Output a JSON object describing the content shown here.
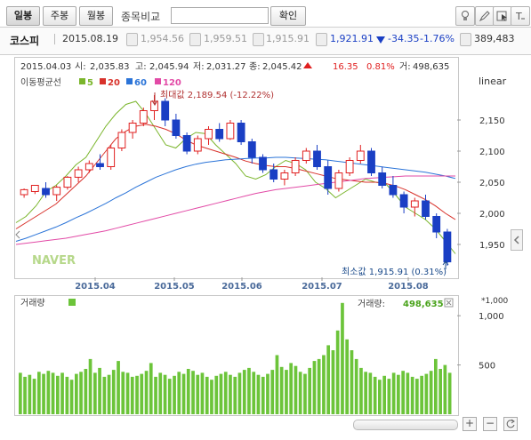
{
  "toolbar": {
    "daily_label": "일봉",
    "weekly_label": "주봉",
    "monthly_label": "월봉",
    "compare_label": "종목비교",
    "compare_input_value": "",
    "confirm_label": "확인"
  },
  "quote": {
    "name": "코스피",
    "date": "2015.08.19",
    "open": "1,954.56",
    "high": "1,959.51",
    "low": "1,915.91",
    "close": "1,921.91",
    "change": "-34.35",
    "change_rate": "-1.76%",
    "volume": "389,483"
  },
  "info_bar": {
    "date": "2015.04.03",
    "open_label": "시:",
    "open": "2,035.83",
    "high_label": "고:",
    "high": "2,045.94",
    "low_label": "저:",
    "low": "2,031.27",
    "close_label": "종:",
    "close": "2,045.42",
    "change": "16.35",
    "change_rate": "0.81%",
    "volume_label": "거:",
    "volume": "498,635"
  },
  "ma_legend": {
    "title": "이동평균선",
    "items": [
      {
        "label": "5",
        "color": "#7ab52b"
      },
      {
        "label": "20",
        "color": "#d8322b"
      },
      {
        "label": "60",
        "color": "#2b74d8"
      },
      {
        "label": "120",
        "color": "#e24aa6"
      }
    ]
  },
  "scale_label": "linear",
  "watermark": "NAVER",
  "max_annotation": "최대값 2,189.54 (-12.22%)",
  "min_annotation": "최소값 1,915.91 (0.31%)",
  "volume_panel": {
    "title": "거래량",
    "label": "거래량:",
    "value": "498,635",
    "unit_label": "*1,000",
    "color": "#6cc43a"
  },
  "colors": {
    "up": "#e02020",
    "down": "#1a3fc4",
    "ma5": "#7ab52b",
    "ma20": "#d8322b",
    "ma60": "#2b74d8",
    "ma120": "#e24aa6",
    "volume": "#6cc43a"
  },
  "chart_data": [
    {
      "type": "candlestick",
      "title": "코스피",
      "x_tick_labels": [
        "2015.04",
        "2015.05",
        "2015.06",
        "2015.07",
        "2015.08"
      ],
      "y_tick_labels": [
        "1,950",
        "2,000",
        "2,050",
        "2,100",
        "2,150"
      ],
      "ylim": [
        1900,
        2200
      ],
      "y_scale": "linear",
      "grid": false,
      "series": [
        {
          "name": "5",
          "values": [
            1985,
            1995,
            2012,
            2035,
            2045,
            2060,
            2078,
            2090,
            2115,
            2140,
            2160,
            2175,
            2180,
            2160,
            2135,
            2110,
            2105,
            2120,
            2130,
            2128,
            2110,
            2095,
            2080,
            2060,
            2055,
            2062,
            2075,
            2085,
            2080,
            2070,
            2050,
            2040,
            2025,
            2035,
            2045,
            2055,
            2050,
            2048,
            2030,
            2010,
            2000,
            1990,
            1975,
            1955,
            1935
          ]
        },
        {
          "name": "20",
          "values": [
            1975,
            1985,
            1995,
            2005,
            2015,
            2030,
            2045,
            2060,
            2080,
            2100,
            2120,
            2132,
            2140,
            2143,
            2140,
            2135,
            2128,
            2118,
            2110,
            2105,
            2100,
            2095,
            2090,
            2084,
            2080,
            2077,
            2075,
            2075,
            2072,
            2068,
            2064,
            2060,
            2056,
            2054,
            2052,
            2050,
            2050,
            2048,
            2044,
            2038,
            2030,
            2022,
            2012,
            2000,
            1990
          ]
        },
        {
          "name": "60",
          "values": [
            1955,
            1960,
            1966,
            1972,
            1978,
            1985,
            1993,
            2000,
            2008,
            2016,
            2025,
            2033,
            2042,
            2050,
            2058,
            2064,
            2070,
            2075,
            2079,
            2082,
            2084,
            2086,
            2087,
            2088,
            2089,
            2089,
            2090,
            2090,
            2089,
            2088,
            2087,
            2086,
            2084,
            2082,
            2080,
            2078,
            2076,
            2074,
            2072,
            2070,
            2068,
            2066,
            2063,
            2060,
            2056
          ]
        },
        {
          "name": "120",
          "values": [
            1950,
            1952,
            1954,
            1956,
            1958,
            1960,
            1963,
            1966,
            1969,
            1972,
            1976,
            1980,
            1984,
            1988,
            1992,
            1996,
            2000,
            2004,
            2008,
            2012,
            2016,
            2020,
            2024,
            2028,
            2032,
            2035,
            2038,
            2040,
            2042,
            2044,
            2046,
            2048,
            2050,
            2052,
            2054,
            2056,
            2057,
            2058,
            2059,
            2060,
            2060,
            2060,
            2060,
            2060,
            2060
          ]
        }
      ],
      "candles": [
        [
          2030,
          2040,
          2025,
          2038
        ],
        [
          2035,
          2045,
          2031,
          2045
        ],
        [
          2040,
          2050,
          2025,
          2030
        ],
        [
          2030,
          2045,
          2020,
          2042
        ],
        [
          2042,
          2060,
          2038,
          2058
        ],
        [
          2058,
          2075,
          2050,
          2070
        ],
        [
          2070,
          2085,
          2065,
          2080
        ],
        [
          2080,
          2095,
          2070,
          2075
        ],
        [
          2075,
          2110,
          2070,
          2105
        ],
        [
          2105,
          2135,
          2100,
          2130
        ],
        [
          2130,
          2150,
          2120,
          2145
        ],
        [
          2145,
          2170,
          2140,
          2165
        ],
        [
          2165,
          2190,
          2150,
          2180
        ],
        [
          2180,
          2185,
          2140,
          2150
        ],
        [
          2150,
          2160,
          2120,
          2125
        ],
        [
          2125,
          2130,
          2095,
          2100
        ],
        [
          2100,
          2125,
          2095,
          2120
        ],
        [
          2120,
          2140,
          2110,
          2135
        ],
        [
          2135,
          2145,
          2115,
          2120
        ],
        [
          2120,
          2150,
          2118,
          2145
        ],
        [
          2145,
          2150,
          2110,
          2115
        ],
        [
          2115,
          2120,
          2080,
          2090
        ],
        [
          2090,
          2095,
          2065,
          2070
        ],
        [
          2070,
          2080,
          2050,
          2055
        ],
        [
          2055,
          2070,
          2045,
          2065
        ],
        [
          2065,
          2090,
          2060,
          2085
        ],
        [
          2085,
          2105,
          2080,
          2100
        ],
        [
          2100,
          2110,
          2070,
          2075
        ],
        [
          2075,
          2085,
          2030,
          2040
        ],
        [
          2040,
          2070,
          2035,
          2065
        ],
        [
          2065,
          2090,
          2060,
          2085
        ],
        [
          2085,
          2110,
          2080,
          2100
        ],
        [
          2100,
          2105,
          2060,
          2065
        ],
        [
          2065,
          2075,
          2040,
          2045
        ],
        [
          2045,
          2060,
          2025,
          2030
        ],
        [
          2030,
          2035,
          2000,
          2010
        ],
        [
          2010,
          2025,
          1995,
          2020
        ],
        [
          2020,
          2030,
          1990,
          1995
        ],
        [
          1995,
          2000,
          1960,
          1970
        ],
        [
          1970,
          1975,
          1916,
          1922
        ]
      ],
      "max_value": 2189.54,
      "min_value": 1915.91
    },
    {
      "type": "bar",
      "title": "거래량",
      "unit": "*1,000",
      "y_tick_labels": [
        "500",
        "1,000"
      ],
      "ylim": [
        0,
        1200
      ],
      "values": [
        420,
        380,
        400,
        360,
        430,
        410,
        440,
        420,
        390,
        420,
        380,
        350,
        410,
        430,
        460,
        560,
        420,
        470,
        380,
        400,
        450,
        540,
        430,
        420,
        380,
        390,
        410,
        440,
        520,
        380,
        420,
        400,
        360,
        390,
        430,
        410,
        460,
        440,
        400,
        420,
        380,
        350,
        390,
        410,
        430,
        400,
        380,
        420,
        450,
        470,
        430,
        400,
        380,
        410,
        450,
        600,
        480,
        450,
        520,
        490,
        430,
        410,
        470,
        540,
        560,
        600,
        700,
        650,
        850,
        1130,
        760,
        650,
        560,
        470,
        430,
        420,
        380,
        350,
        390,
        360,
        420,
        400,
        440,
        420,
        380,
        360,
        390,
        410,
        440,
        560,
        460,
        500,
        420
      ]
    }
  ]
}
